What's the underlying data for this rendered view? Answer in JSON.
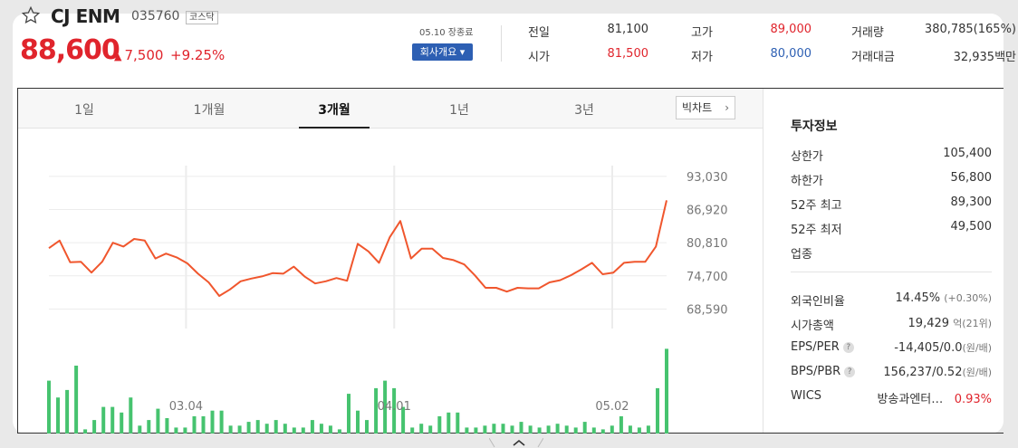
{
  "stock": {
    "name": "CJ ENM",
    "code": "035760",
    "market": "코스닥",
    "price": "88,600",
    "change": "7,500",
    "change_pct": "+9.25%",
    "close_note": "05.10 장종료",
    "company_button": "회사개요 ▾"
  },
  "quote": {
    "prev_close_label": "전일",
    "prev_close": "81,100",
    "open_label": "시가",
    "open": "81,500",
    "high_label": "고가",
    "high": "89,000",
    "low_label": "저가",
    "low": "80,000",
    "volume_label": "거래량",
    "volume": "380,785(165%)",
    "amount_label": "거래대금",
    "amount": "32,935백만"
  },
  "tabs": [
    {
      "label": "1일"
    },
    {
      "label": "1개월"
    },
    {
      "label": "3개월"
    },
    {
      "label": "1년"
    },
    {
      "label": "3년"
    }
  ],
  "active_tab": "3개월",
  "big_chart_label": "빅차트",
  "chart_data": {
    "type": "line",
    "y_ticks": [
      "93,030",
      "86,920",
      "80,810",
      "74,700",
      "68,590"
    ],
    "x_ticks": [
      "03.04",
      "04.01",
      "05.02"
    ],
    "ylim": [
      65000,
      95000
    ],
    "series": [
      {
        "values": [
          79800,
          81200,
          77200,
          77300,
          75300,
          77300,
          80800,
          80100,
          81500,
          81200,
          77900,
          78800,
          78100,
          77000,
          75100,
          73500,
          71000,
          72200,
          73700,
          74200,
          74600,
          75200,
          75100,
          76400,
          74600,
          73300,
          73700,
          74300,
          73800,
          80600,
          79200,
          77100,
          81800,
          84800,
          77900,
          79700,
          79700,
          78000,
          77600,
          76800,
          74800,
          72500,
          72500,
          71800,
          72500,
          72400,
          72400,
          73500,
          73900,
          74800,
          75900,
          77100,
          75000,
          75300,
          77100,
          77300,
          77300,
          80100,
          88600
        ]
      }
    ],
    "volume": [
      3400,
      2500,
      2900,
      4200,
      800,
      1300,
      2000,
      2000,
      1700,
      2500,
      1000,
      1300,
      1900,
      1400,
      900,
      900,
      1500,
      1500,
      1800,
      1800,
      1000,
      1000,
      1200,
      1300,
      1100,
      1300,
      1100,
      900,
      900,
      1300,
      1100,
      1000,
      800,
      2700,
      1800,
      1300,
      3000,
      3400,
      3000,
      2000,
      900,
      1100,
      1000,
      1500,
      1700,
      1700,
      900,
      900,
      1000,
      1100,
      1100,
      1000,
      1200,
      1000,
      900,
      1000,
      1100,
      1000,
      900,
      1200,
      900,
      800,
      1000,
      1500,
      1000,
      900,
      1000,
      3000,
      5100
    ],
    "vlim": [
      0,
      5600
    ]
  },
  "invest": {
    "title": "투자정보",
    "rows": [
      {
        "label": "상한가",
        "value": "105,400"
      },
      {
        "label": "하한가",
        "value": "56,800"
      },
      {
        "label": "52주 최고",
        "value": "89,300"
      },
      {
        "label": "52주 최저",
        "value": "49,500"
      },
      {
        "label": "업종",
        "value": ""
      }
    ],
    "rows2": [
      {
        "label": "외국인비율",
        "value": "14.45%",
        "sub": "(+0.30%)"
      },
      {
        "label": "시가총액",
        "value": "19,429",
        "sub": "억(21위)"
      },
      {
        "label": "EPS/PER",
        "value": "-14,405/0.0",
        "sub": "(원/배)"
      },
      {
        "label": "BPS/PBR",
        "value": "156,237/0.52",
        "sub": "(원/배)"
      },
      {
        "label": "WICS",
        "value": "방송과엔터…",
        "sub": "0.93%"
      }
    ],
    "help_glyph": "?"
  },
  "colors": {
    "up": "#e0242c",
    "down": "#2d5fb3",
    "line": "#f0562d",
    "volume": "#46c36f"
  }
}
